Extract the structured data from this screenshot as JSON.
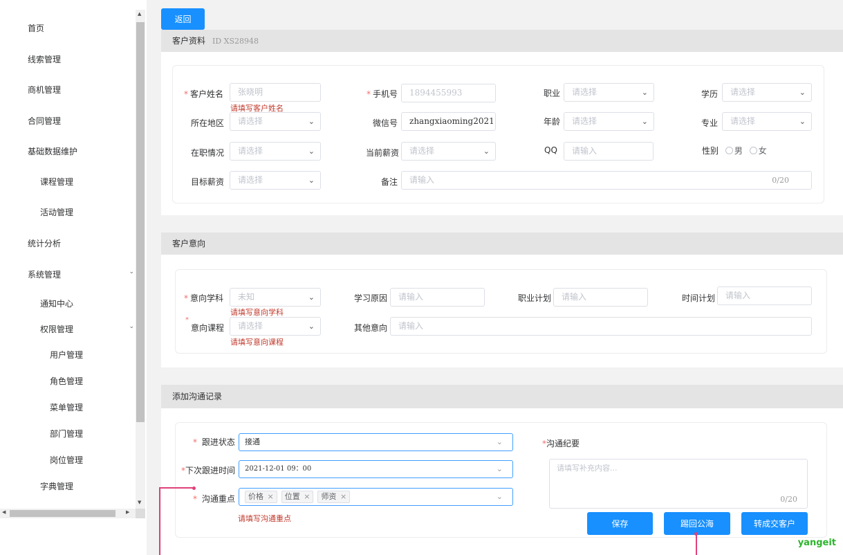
{
  "sidebar": {
    "items": [
      {
        "label": "首页"
      },
      {
        "label": "线索管理"
      },
      {
        "label": "商机管理"
      },
      {
        "label": "合同管理"
      },
      {
        "label": "基础数据维护"
      },
      {
        "label": "课程管理"
      },
      {
        "label": "活动管理"
      },
      {
        "label": "统计分析"
      },
      {
        "label": "系统管理"
      },
      {
        "label": "通知中心"
      },
      {
        "label": "权限管理"
      },
      {
        "label": "用户管理"
      },
      {
        "label": "角色管理"
      },
      {
        "label": "菜单管理"
      },
      {
        "label": "部门管理"
      },
      {
        "label": "岗位管理"
      },
      {
        "label": "字典管理"
      }
    ]
  },
  "back_button": "返回",
  "customer_info": {
    "title": "客户资料",
    "id_text": "ID XS28948",
    "name": {
      "label": "客户姓名",
      "placeholder": "张晓明",
      "error": "请填写客户姓名"
    },
    "phone": {
      "label": "手机号",
      "placeholder": "1894455993"
    },
    "occupation": {
      "label": "职业",
      "placeholder": "请选择"
    },
    "education": {
      "label": "学历",
      "placeholder": "请选择"
    },
    "region": {
      "label": "所在地区",
      "placeholder": "请选择"
    },
    "wechat": {
      "label": "微信号",
      "value": "zhangxiaoming2021"
    },
    "age": {
      "label": "年龄",
      "placeholder": "请选择"
    },
    "major": {
      "label": "专业",
      "placeholder": "请选择"
    },
    "job_status": {
      "label": "在职情况",
      "placeholder": "请选择"
    },
    "current_salary": {
      "label": "当前薪资",
      "placeholder": "请选择"
    },
    "qq": {
      "label": "QQ",
      "placeholder": "请输入"
    },
    "gender": {
      "label": "性别",
      "options": [
        "男",
        "女"
      ]
    },
    "target_salary": {
      "label": "目标薪资",
      "placeholder": "请选择"
    },
    "remark": {
      "label": "备注",
      "placeholder": "请输入",
      "count": "0/20"
    }
  },
  "intent": {
    "title": "客户意向",
    "subject": {
      "label": "意向学科",
      "placeholder": "未知",
      "error": "请填写意向学科"
    },
    "reason": {
      "label": "学习原因",
      "placeholder": "请输入"
    },
    "career_plan": {
      "label": "职业计划",
      "placeholder": "请输入"
    },
    "time_plan": {
      "label": "时间计划",
      "placeholder": "请输入"
    },
    "course": {
      "label": "意向课程",
      "placeholder": "请选择",
      "error": "请填写意向课程"
    },
    "other": {
      "label": "其他意向",
      "placeholder": "请输入"
    }
  },
  "communication": {
    "title": "添加沟通记录",
    "status": {
      "label": "跟进状态",
      "value": "接通"
    },
    "next_time": {
      "label": "下次跟进时间",
      "value": "2021-12-01  09：00"
    },
    "focus": {
      "label": "沟通重点",
      "tags": [
        "价格",
        "位置",
        "师资"
      ],
      "error": "请填写沟通重点"
    },
    "summary": {
      "label": "沟通纪要",
      "placeholder": "请填写补充内容...",
      "count": "0/20"
    },
    "buttons": {
      "save": "保存",
      "return_pool": "踢回公海",
      "convert": "转成交客户"
    }
  },
  "watermark": "yangeit",
  "colors": {
    "primary": "#1890ff",
    "required": "#f56c6c",
    "annotation": "#e0407a"
  }
}
